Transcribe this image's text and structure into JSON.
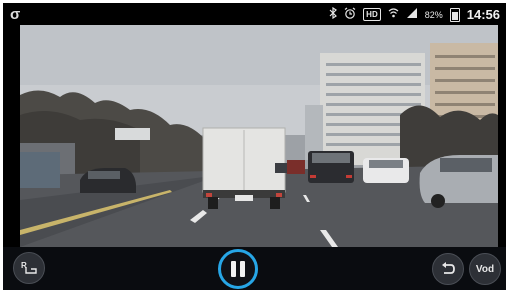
{
  "status_bar": {
    "carrier_logo": "σ",
    "bluetooth_icon": "bluetooth-icon",
    "alarm_icon": "alarm-icon",
    "hd_label": "HD",
    "wifi_icon": "wifi-icon",
    "signal_icon": "signal-icon",
    "battery_percent": "82%",
    "time": "14:56"
  },
  "player": {
    "state": "playing",
    "ratio_label": "R",
    "vod_label": "Vod",
    "back_icon": "undo-arrow-icon",
    "pause_icon": "pause-icon",
    "accent_color": "#27a6e6"
  }
}
